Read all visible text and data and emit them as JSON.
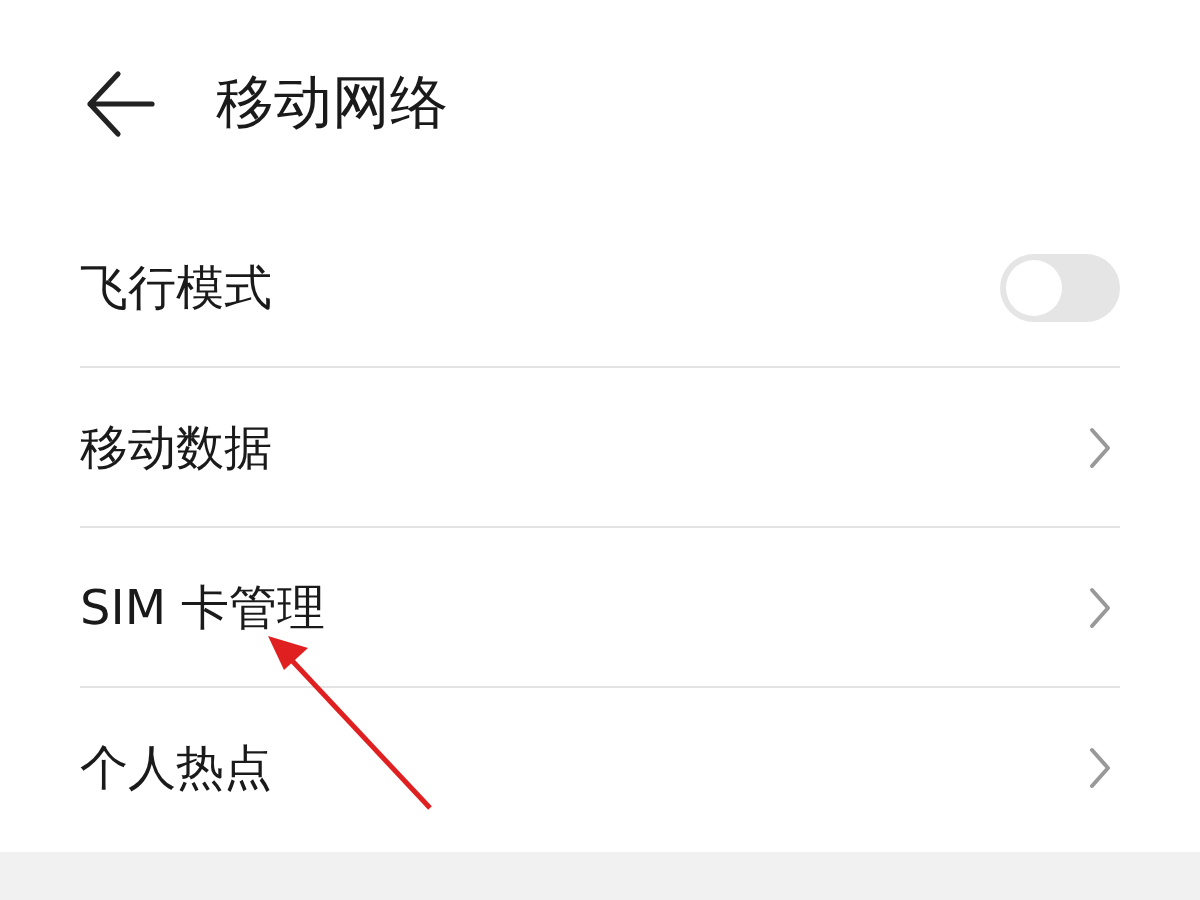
{
  "header": {
    "title": "移动网络"
  },
  "items": [
    {
      "kind": "toggle",
      "label": "飞行模式",
      "on": false
    },
    {
      "kind": "link",
      "label": "移动数据"
    },
    {
      "kind": "link",
      "label": "SIM 卡管理"
    },
    {
      "kind": "link",
      "label": "个人热点"
    }
  ]
}
